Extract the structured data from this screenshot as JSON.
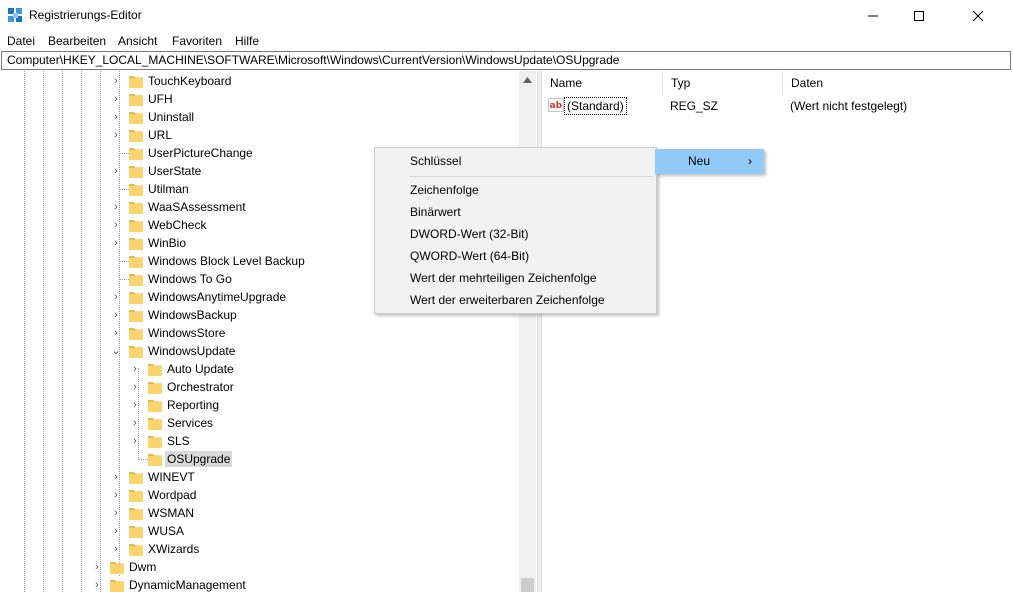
{
  "window": {
    "title": "Registrierungs-Editor",
    "minimize_glyph": "—",
    "maximize_glyph": "☐",
    "close_glyph": "✕"
  },
  "menu": [
    "Datei",
    "Bearbeiten",
    "Ansicht",
    "Favoriten",
    "Hilfe"
  ],
  "address": "Computer\\HKEY_LOCAL_MACHINE\\SOFTWARE\\Microsoft\\Windows\\CurrentVersion\\WindowsUpdate\\OSUpgrade",
  "tree": [
    {
      "label": "TouchKeyboard",
      "expander": "›"
    },
    {
      "label": "UFH",
      "expander": "›"
    },
    {
      "label": "Uninstall",
      "expander": "›"
    },
    {
      "label": "URL",
      "expander": "›"
    },
    {
      "label": "UserPictureChange",
      "expander": ""
    },
    {
      "label": "UserState",
      "expander": "›"
    },
    {
      "label": "Utilman",
      "expander": ""
    },
    {
      "label": "WaaSAssessment",
      "expander": "›"
    },
    {
      "label": "WebCheck",
      "expander": "›"
    },
    {
      "label": "WinBio",
      "expander": "›"
    },
    {
      "label": "Windows Block Level Backup",
      "expander": ""
    },
    {
      "label": "Windows To Go",
      "expander": ""
    },
    {
      "label": "WindowsAnytimeUpgrade",
      "expander": "›"
    },
    {
      "label": "WindowsBackup",
      "expander": "›"
    },
    {
      "label": "WindowsStore",
      "expander": "›"
    },
    {
      "label": "WindowsUpdate",
      "expander": "⌄"
    },
    {
      "label": "Auto Update",
      "expander": "›"
    },
    {
      "label": "Orchestrator",
      "expander": "›"
    },
    {
      "label": "Reporting",
      "expander": "›"
    },
    {
      "label": "Services",
      "expander": "›"
    },
    {
      "label": "SLS",
      "expander": "›"
    },
    {
      "label": "OSUpgrade",
      "expander": ""
    },
    {
      "label": "WINEVT",
      "expander": "›"
    },
    {
      "label": "Wordpad",
      "expander": "›"
    },
    {
      "label": "WSMAN",
      "expander": "›"
    },
    {
      "label": "WUSA",
      "expander": "›"
    },
    {
      "label": "XWizards",
      "expander": "›"
    },
    {
      "label": "Dwm",
      "expander": "›"
    },
    {
      "label": "DynamicManagement",
      "expander": "›"
    }
  ],
  "list": {
    "columns": [
      "Name",
      "Typ",
      "Daten"
    ],
    "rows": [
      {
        "name": "(Standard)",
        "type": "REG_SZ",
        "data": "(Wert nicht festgelegt)",
        "icon_text": "ab"
      }
    ]
  },
  "context_menu": {
    "items": [
      "Schlüssel",
      "Zeichenfolge",
      "Binärwert",
      "DWORD-Wert (32-Bit)",
      "QWORD-Wert (64-Bit)",
      "Wert der mehrteiligen Zeichenfolge",
      "Wert der erweiterbaren Zeichenfolge"
    ],
    "parent_item": "Neu",
    "parent_arrow": "›",
    "highlight_color": "#91c9f7"
  }
}
